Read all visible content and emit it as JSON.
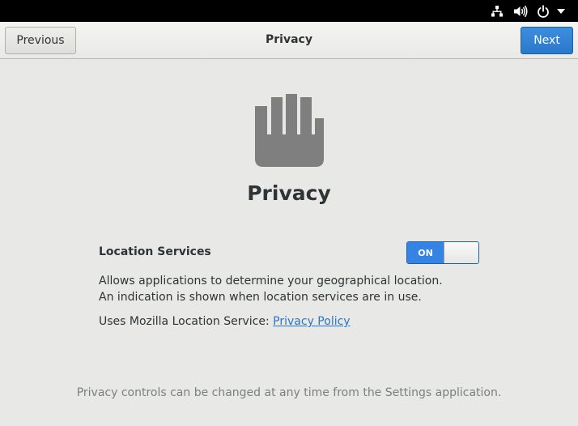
{
  "header": {
    "previous_label": "Previous",
    "title": "Privacy",
    "next_label": "Next"
  },
  "tray": {
    "icons": [
      "network-icon",
      "volume-icon",
      "power-icon",
      "chevron-down-icon"
    ]
  },
  "main": {
    "title": "Privacy",
    "location": {
      "label": "Location Services",
      "switch_state": "ON",
      "description": "Allows applications to determine your geographical location. An indication is shown when location services are in use.",
      "service_prefix": "Uses Mozilla Location Service: ",
      "policy_link": "Privacy Policy"
    },
    "footer_note": "Privacy controls can be changed at any time from the Settings application."
  },
  "colors": {
    "accent": "#3584e4",
    "link": "#2a76c6",
    "background": "#e8e8e7",
    "topbar": "#000000",
    "icon_gray": "#7f7f7f"
  }
}
